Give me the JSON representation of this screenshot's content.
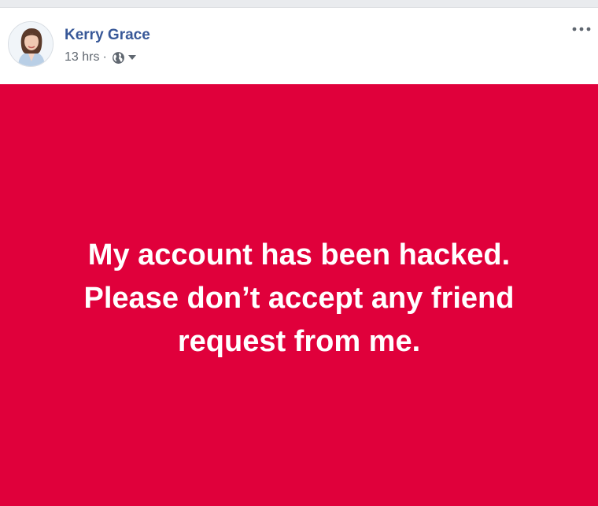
{
  "post": {
    "author": "Kerry Grace",
    "timestamp": "13 hrs",
    "separator": "·",
    "audience_icon": "globe-icon",
    "menu_icon": "more-options-icon",
    "body_lines": [
      "My account has been hacked.",
      "Please don’t accept any friend",
      "request from me."
    ],
    "background_color": "#e0003b",
    "text_color": "#ffffff",
    "name_color": "#385898"
  }
}
